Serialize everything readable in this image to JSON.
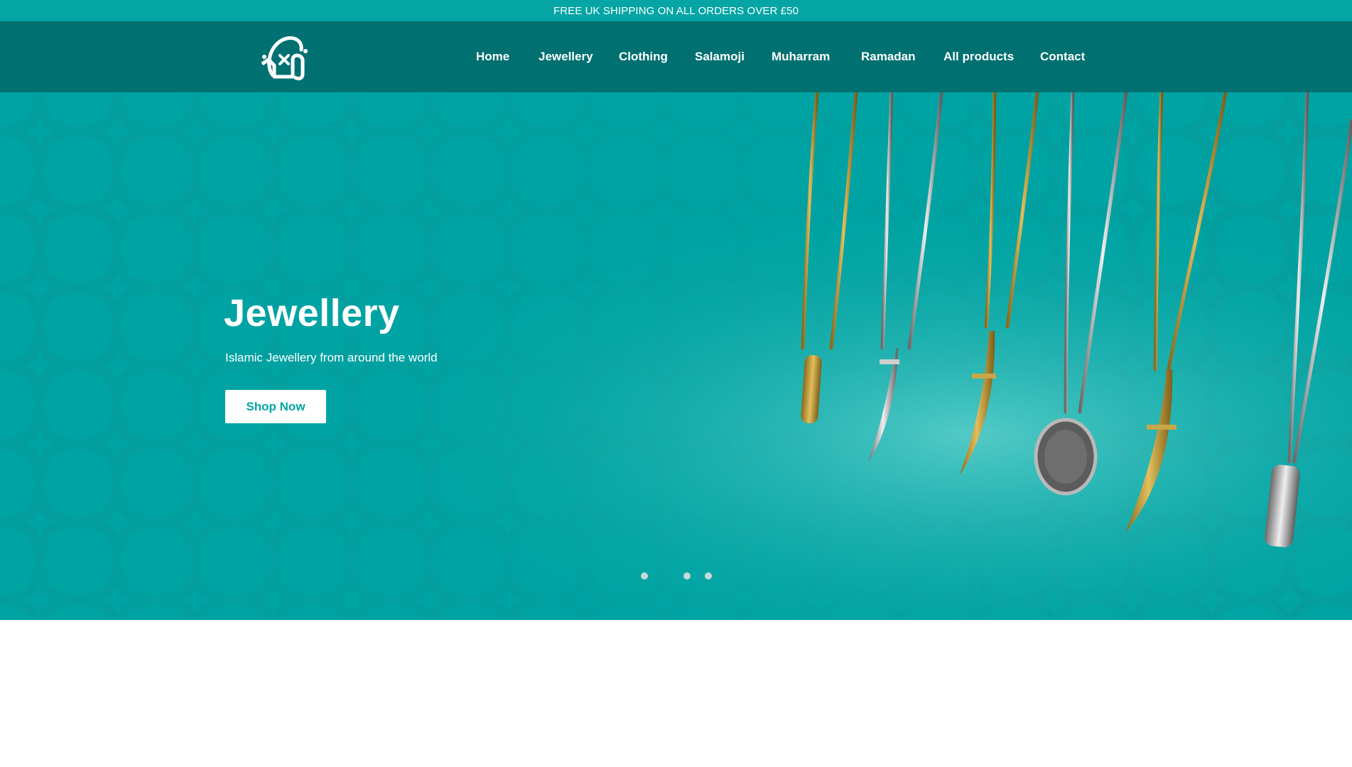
{
  "announcement": {
    "text": "FREE UK SHIPPING ON ALL ORDERS OVER £50"
  },
  "header": {
    "logo_icon": "calligraphy-logo-icon",
    "nav": [
      {
        "label": "Home"
      },
      {
        "label": "Jewellery"
      },
      {
        "label": "Clothing"
      },
      {
        "label": "Salamoji"
      },
      {
        "label": "Muharram"
      },
      {
        "label": "Ramadan"
      },
      {
        "label": "All products"
      },
      {
        "label": "Contact"
      }
    ]
  },
  "hero": {
    "title": "Jewellery",
    "subtitle": "Islamic Jewellery from around the world",
    "cta_label": "Shop Now",
    "slides_count": 3
  },
  "colors": {
    "announcement_bg": "#04a5a4",
    "header_bg": "#017071",
    "hero_bg": "#00a3a3",
    "cta_text": "#04a5a4",
    "white": "#ffffff"
  }
}
